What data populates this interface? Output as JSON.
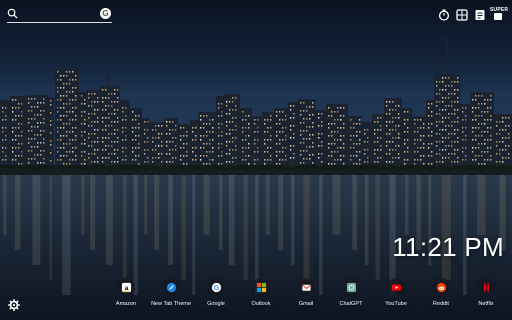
{
  "search": {
    "placeholder": "",
    "engine_icon": "google-g-icon",
    "engine_label": "G"
  },
  "toolbar": {
    "items": [
      {
        "icon": "timer-icon"
      },
      {
        "icon": "apps-grid-icon"
      },
      {
        "icon": "todo-icon"
      },
      {
        "icon": "super-icon",
        "badge": "SUPER"
      }
    ]
  },
  "clock": {
    "time": "11:21 PM"
  },
  "dock": {
    "items": [
      {
        "label": "Amazon",
        "icon": "amazon-icon",
        "color": "#000000"
      },
      {
        "label": "New Tab Theme",
        "icon": "new-tab-theme-icon",
        "color": "#1e88e5"
      },
      {
        "label": "Google",
        "icon": "google-icon",
        "color": "#4285f4"
      },
      {
        "label": "Outlook",
        "icon": "outlook-icon",
        "color": "#f25022"
      },
      {
        "label": "Gmail",
        "icon": "gmail-icon",
        "color": "#ea4335"
      },
      {
        "label": "ChatGPT",
        "icon": "chatgpt-icon",
        "color": "#74aa9c"
      },
      {
        "label": "YouTube",
        "icon": "youtube-icon",
        "color": "#ff0000"
      },
      {
        "label": "Reddit",
        "icon": "reddit-icon",
        "color": "#ff4500"
      },
      {
        "label": "Netflix",
        "icon": "netflix-icon",
        "color": "#e50914"
      }
    ]
  },
  "settings": {
    "icon": "gear-icon"
  },
  "wallpaper": {
    "subject": "Chicago skyline at night over Lake Michigan"
  }
}
